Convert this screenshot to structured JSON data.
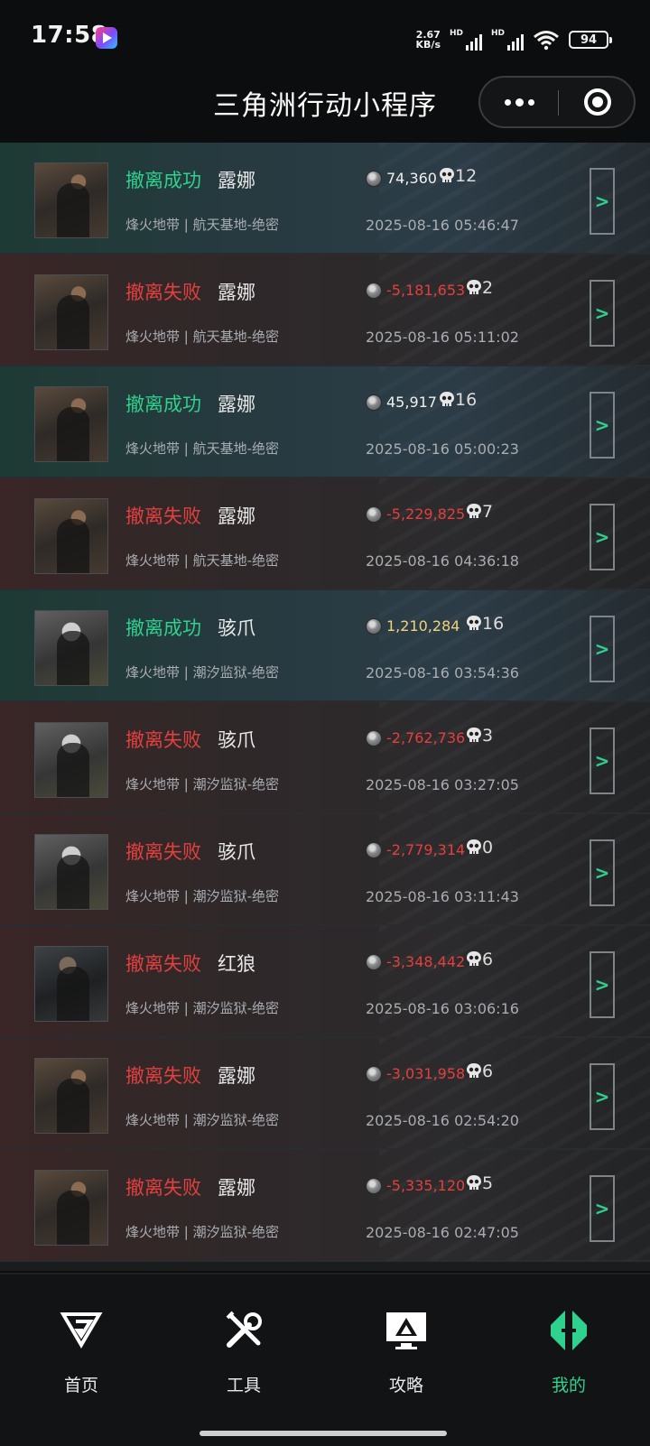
{
  "status_bar": {
    "time": "17:58",
    "net_speed_value": "2.67",
    "net_speed_unit": "KB/s",
    "sim1_label": "HD",
    "sim2_label": "HD",
    "battery": "94"
  },
  "header": {
    "title": "三角洲行动小程序"
  },
  "records": [
    {
      "result": "撤离成功",
      "status": "success",
      "operator": "露娜",
      "avatar": "luna",
      "map": "烽火地带 | 航天基地-绝密",
      "coins": "74,360",
      "coin_style": "pos",
      "kills": "12",
      "time": "2025-08-16 05:46:47",
      "detail": ">"
    },
    {
      "result": "撤离失败",
      "status": "fail",
      "operator": "露娜",
      "avatar": "luna",
      "map": "烽火地带 | 航天基地-绝密",
      "coins": "-5,181,653",
      "coin_style": "neg",
      "kills": "2",
      "time": "2025-08-16 05:11:02",
      "detail": ">"
    },
    {
      "result": "撤离成功",
      "status": "success",
      "operator": "露娜",
      "avatar": "luna",
      "map": "烽火地带 | 航天基地-绝密",
      "coins": "45,917",
      "coin_style": "pos",
      "kills": "16",
      "time": "2025-08-16 05:00:23",
      "detail": ">"
    },
    {
      "result": "撤离失败",
      "status": "fail",
      "operator": "露娜",
      "avatar": "luna",
      "map": "烽火地带 | 航天基地-绝密",
      "coins": "-5,229,825",
      "coin_style": "neg",
      "kills": "7",
      "time": "2025-08-16 04:36:18",
      "detail": ">"
    },
    {
      "result": "撤离成功",
      "status": "success",
      "operator": "骇爪",
      "avatar": "claw",
      "map": "烽火地带 | 潮汐监狱-绝密",
      "coins": "1,210,284",
      "coin_style": "gold",
      "kills": "16",
      "time": "2025-08-16 03:54:36",
      "detail": ">"
    },
    {
      "result": "撤离失败",
      "status": "fail",
      "operator": "骇爪",
      "avatar": "claw",
      "map": "烽火地带 | 潮汐监狱-绝密",
      "coins": "-2,762,736",
      "coin_style": "neg",
      "kills": "3",
      "time": "2025-08-16 03:27:05",
      "detail": ">"
    },
    {
      "result": "撤离失败",
      "status": "fail",
      "operator": "骇爪",
      "avatar": "claw",
      "map": "烽火地带 | 潮汐监狱-绝密",
      "coins": "-2,779,314",
      "coin_style": "neg",
      "kills": "0",
      "time": "2025-08-16 03:11:43",
      "detail": ">"
    },
    {
      "result": "撤离失败",
      "status": "fail",
      "operator": "红狼",
      "avatar": "wolf",
      "map": "烽火地带 | 潮汐监狱-绝密",
      "coins": "-3,348,442",
      "coin_style": "neg",
      "kills": "6",
      "time": "2025-08-16 03:06:16",
      "detail": ">"
    },
    {
      "result": "撤离失败",
      "status": "fail",
      "operator": "露娜",
      "avatar": "luna",
      "map": "烽火地带 | 潮汐监狱-绝密",
      "coins": "-3,031,958",
      "coin_style": "neg",
      "kills": "6",
      "time": "2025-08-16 02:54:20",
      "detail": ">"
    },
    {
      "result": "撤离失败",
      "status": "fail",
      "operator": "露娜",
      "avatar": "luna",
      "map": "烽火地带 | 潮汐监狱-绝密",
      "coins": "-5,335,120",
      "coin_style": "neg",
      "kills": "5",
      "time": "2025-08-16 02:47:05",
      "detail": ">"
    }
  ],
  "tabs": [
    {
      "label": "首页",
      "icon": "home-logo-icon",
      "active": false
    },
    {
      "label": "工具",
      "icon": "tools-icon",
      "active": false
    },
    {
      "label": "攻略",
      "icon": "guide-monitor-icon",
      "active": false
    },
    {
      "label": "我的",
      "icon": "profile-logo-icon",
      "active": true
    }
  ],
  "colors": {
    "success": "#2fd18e",
    "fail": "#e2403e",
    "gold_value": "#f0d27a",
    "active_tab": "#2fd18e"
  }
}
